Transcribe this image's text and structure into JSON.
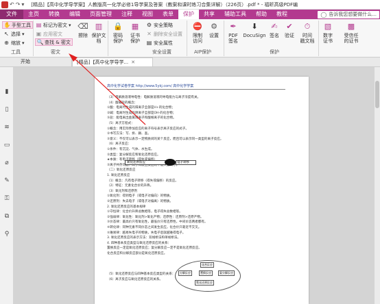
{
  "window": {
    "title": "[精品]【高中化学导学案】人教版高一化学必修1导学案及答案（教案和课时练习合集详解）（226页）.pdf * - 福昕高级PDF编",
    "quick_access": [
      "↶",
      "↷",
      "▾"
    ]
  },
  "menu": {
    "file": "文件",
    "tabs": [
      "主页",
      "转换",
      "编辑",
      "页面管理",
      "注释",
      "视图",
      "表单",
      "保护",
      "共享",
      "辅助工具",
      "帮助",
      "教程"
    ],
    "active": "保护",
    "tellme": "告诉我您想要做什么..."
  },
  "ribbon": {
    "tools": {
      "hand": "手型工具",
      "select": "选择",
      "zoom": "缩放",
      "label": "工具"
    },
    "redact": {
      "mark": "标记为密文",
      "apply": "应用密文",
      "search": "查找 & 密文",
      "erase": "擦除",
      "protect": "保护文档",
      "label": "密文"
    },
    "secure": {
      "pwd": "密码\n保护",
      "cert": "证书\n保护",
      "mgr": "安全策略",
      "remove": "删除安全设置",
      "props": "安全属性",
      "label": "安全设置"
    },
    "aip": {
      "restrict": "限制\n访问",
      "settings": "设置",
      "label": "AIP保护"
    },
    "sign": {
      "pdf": "PDF\n签名",
      "docusign": "DocuSign",
      "sign": "签名",
      "validate": "验证",
      "time": "时间\n戳文档",
      "cert_id": "数字\n证书",
      "trust": "受信任\n的证书",
      "label": "保护"
    },
    "protect_more": {
      "label": "保护\n文档"
    }
  },
  "doctabs": {
    "start": "开始",
    "current": "[精品]【高中化学导学..."
  },
  "document": {
    "header": "高中化学试卷学案  http://www.5ykj.com/    高中化学学案",
    "lines": [
      "（3）电解质溶液导电性：电解质溶液的导电能力与离子浓度有关。",
      "（4）酸碱盐的概念：",
      "①酸：电离时生成的阳离子全部是H+的化合物；",
      "②碱：电离时生成的阴离子全部是OH-的化合物；",
      "③盐：能电离出金属阳离子和酸根离子的化合物。",
      "（5）离子方程式：",
      "①概念：用实际参加反应的离子符号表示离子反应的式子。",
      "②书写方法：写、拆、删、查。",
      "③意义：不仅可以表示一定物质间的某个反应，而且可以表示同一类型的离子反应。",
      "（6）离子反应：",
      "①条件：有沉淀、气体、水生成。",
      "②类型：复分解反应和氧化还原反应。",
      "★本质：有电子转移（得失或偏移）",
      "③离子共存问题：离子间发生反应则不能大量共存。",
      "（二）氧化还原反应",
      "1. 氧化还原反应",
      "（1）概念：凡有电子转移（得失或偏移）的反应。",
      "（2）特征：元素化合价的升降。",
      "（3）氧化剂和还原剂",
      "①氧化剂：得到电子（或电子对偏向）的物质。",
      "②还原剂：失去电子（或电子对偏离）的物质。",
      "2. 氧化还原反应的基本规律",
      "①守恒律：化合价升降总数相等，电子得失总数相等。",
      "②强弱律：氧化性：氧化剂>氧化产物；还原性：还原剂>还原产物。",
      "③价态律：最高价只有氧化性，最低价只有还原性，中间价态两者都有。",
      "④转化律：同种元素不同价态之间发生反应，化合价只靠近不交叉。",
      "⑤难易律：越易失电子的物质，失电子后就越难得电子。",
      "3. 氧化还原反应的表示方法：双线桥法和单线桥法。",
      "4. 四种基本反应类型与氧化还原反应的关系：",
      "置换反应一定是氧化还原反应；复分解反应一定不是氧化还原反应。",
      "化合反应和分解反应部分是氧化还原反应。",
      "",
      "",
      "",
      "（5）氧化还原反应与四种基本反应类型的关系：",
      "（6）离子反应与氧化还原反应的关系。"
    ],
    "callout_left": "氧化还原反应",
    "callout_right": "电子转移",
    "diagram": {
      "a": "化合反应",
      "b": "分解反应",
      "c": "置换反应",
      "d": "复分解反应",
      "e": "氧化还原反应"
    }
  }
}
